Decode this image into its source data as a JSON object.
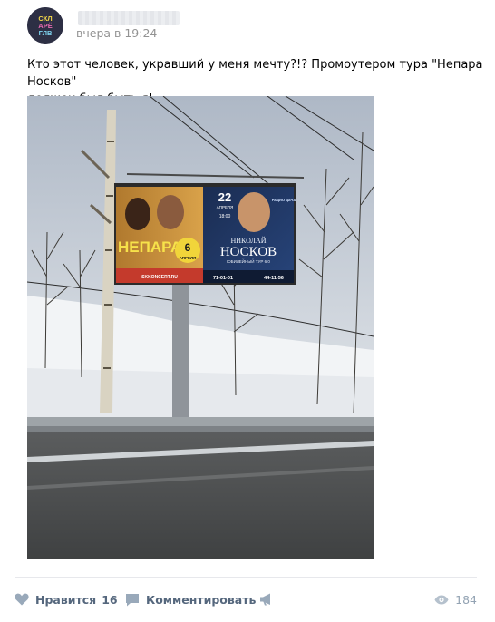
{
  "post": {
    "avatar_lines": [
      "СКЛ",
      "АРЁ",
      "ГЛВ"
    ],
    "avatar_icon": "community-logo",
    "time": "вчера в 19:24",
    "text_line1": "Кто этот человек, укравший у меня мечту?!? Промоутером тура \"Непара Носков\"",
    "text_line2": "должен был быть я!"
  },
  "billboard": {
    "left_title": "НЕПАРА",
    "left_date_day": "6",
    "left_date_month": "АПРЕЛЯ",
    "left_site": "SKKONCERT.RU",
    "right_date_day": "22",
    "right_date_month": "АПРЕЛЯ",
    "right_time": "18:00",
    "right_first_name": "НИКОЛАЙ",
    "right_last_name": "НОСКОВ",
    "right_tour": "ЮБИЛЕЙНЫЙ ТУР 6.0",
    "phone1": "71-01-01",
    "phone2": "44-11-56",
    "radio": "РАДИО ДАЧА"
  },
  "actions": {
    "like_label": "Нравится",
    "like_count": "16",
    "comment_label": "Комментировать",
    "views_count": "184"
  },
  "colors": {
    "action_text": "#55677d",
    "icon": "#99a9ba",
    "time_text": "#939393"
  }
}
